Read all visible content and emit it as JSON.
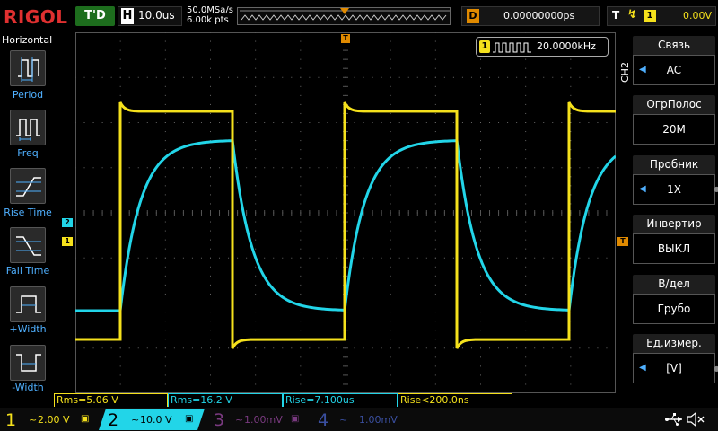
{
  "brand": "RIGOL",
  "trigger_state": "T'D",
  "horizontal": {
    "label": "H",
    "timebase": "10.0us"
  },
  "acquisition": {
    "sample_rate": "50.0MSa/s",
    "mem_depth": "6.00k pts"
  },
  "delay": {
    "label": "D",
    "value": "0.00000000ps"
  },
  "trigger": {
    "label": "T",
    "channel": "1",
    "level": "0.00V"
  },
  "left_menu": {
    "title": "Horizontal",
    "items": [
      {
        "label": "Period",
        "icon": "period-icon"
      },
      {
        "label": "Freq",
        "icon": "freq-icon"
      },
      {
        "label": "Rise Time",
        "icon": "rise-time-icon"
      },
      {
        "label": "Fall Time",
        "icon": "fall-time-icon"
      },
      {
        "label": "+Width",
        "icon": "pos-width-icon"
      },
      {
        "label": "-Width",
        "icon": "neg-width-icon"
      }
    ]
  },
  "freq_counter": {
    "channel": "1",
    "value": "20.0000kHz"
  },
  "markers": {
    "ch2": "2",
    "ch1": "1",
    "trig": "T",
    "trig_top": "T"
  },
  "measurements": [
    {
      "text": "Rms=5.06 V",
      "color": "#f5e11c"
    },
    {
      "text": "Rms=16.2 V",
      "color": "#22d5e8"
    },
    {
      "text": "Rise=7.100us",
      "color": "#22d5e8"
    },
    {
      "text": "Rise<200.0ns",
      "color": "#f5e11c"
    }
  ],
  "channels": [
    {
      "num": "1",
      "coupling": "~",
      "scale": "2.00 V",
      "color": "#f5e11c",
      "active": true
    },
    {
      "num": "2",
      "coupling": "~",
      "scale": "10.0 V",
      "color": "#22d5e8",
      "active": true
    },
    {
      "num": "3",
      "coupling": "~",
      "scale": "1.00mV",
      "color": "#7a3a80",
      "active": false
    },
    {
      "num": "4",
      "coupling": "~",
      "scale": "1.00mV",
      "color": "#3a4fa0",
      "active": false
    }
  ],
  "right_menu": {
    "channel": "CH2",
    "items": [
      {
        "title": "Связь",
        "value": "AC",
        "arrow": true
      },
      {
        "title": "ОгрПолос",
        "value": "20M",
        "arrow": false
      },
      {
        "title": "Пробник",
        "value": "1X",
        "arrow": true
      },
      {
        "title": "Инвертир",
        "value": "ВЫКЛ",
        "arrow": false
      },
      {
        "title": "В/дел",
        "value": "Грубо",
        "arrow": false
      },
      {
        "title": "Ед.измер.",
        "value": "[V]",
        "arrow": true
      }
    ]
  },
  "colors": {
    "ch1": "#f5e11c",
    "ch2": "#22d5e8",
    "trigger": "#e08a00",
    "menu_accent": "#4fb0ff"
  },
  "status_icons": [
    "usb-icon",
    "speaker-muted-icon"
  ]
}
